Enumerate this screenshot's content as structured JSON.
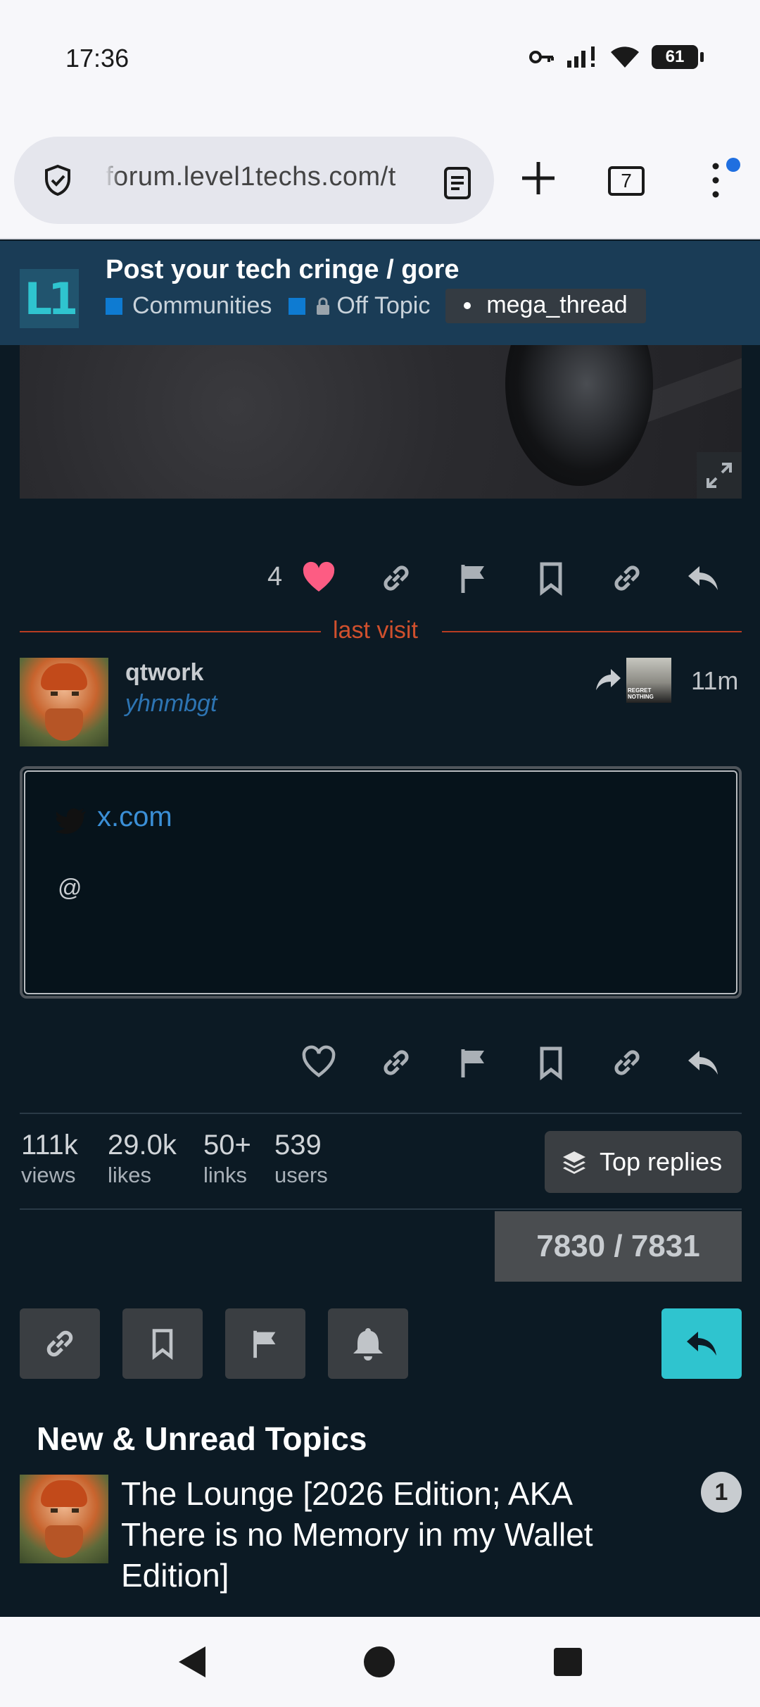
{
  "status_bar": {
    "time": "17:36",
    "battery": "61"
  },
  "browser": {
    "url": "forum.level1techs.com/t",
    "tab_count": "7"
  },
  "topic_header": {
    "logo": "L1",
    "title": "Post your tech cringe / gore",
    "category": "Communities",
    "subcategory": "Off Topic",
    "tag": "mega_thread"
  },
  "post_actions_1": {
    "like_count": "4"
  },
  "last_visit_label": "last visit",
  "post": {
    "username": "qtwork",
    "user_title": "yhnmbgt",
    "reply_avatar_text": "REGRET NOTHING",
    "time": "11m",
    "onebox": {
      "source": "x.com",
      "text": "@"
    }
  },
  "stats": [
    {
      "number": "111k",
      "label": "views"
    },
    {
      "number": "29.0k",
      "label": "likes"
    },
    {
      "number": "50+",
      "label": "links"
    },
    {
      "number": "539",
      "label": "users"
    }
  ],
  "top_replies_label": "Top replies",
  "progress": "7830 / 7831",
  "new_unread": {
    "title": "New & Unread Topics",
    "topic_title": "The Lounge [2026 Edition; AKA There is no Memory in my Wallet Edition]",
    "unread_count": "1"
  },
  "colors": {
    "accent": "#2fc4cf",
    "like": "#fd5c83",
    "header_bg": "#1a3c56",
    "category": "#0e7bd2",
    "last_visit": "#d0502d"
  }
}
